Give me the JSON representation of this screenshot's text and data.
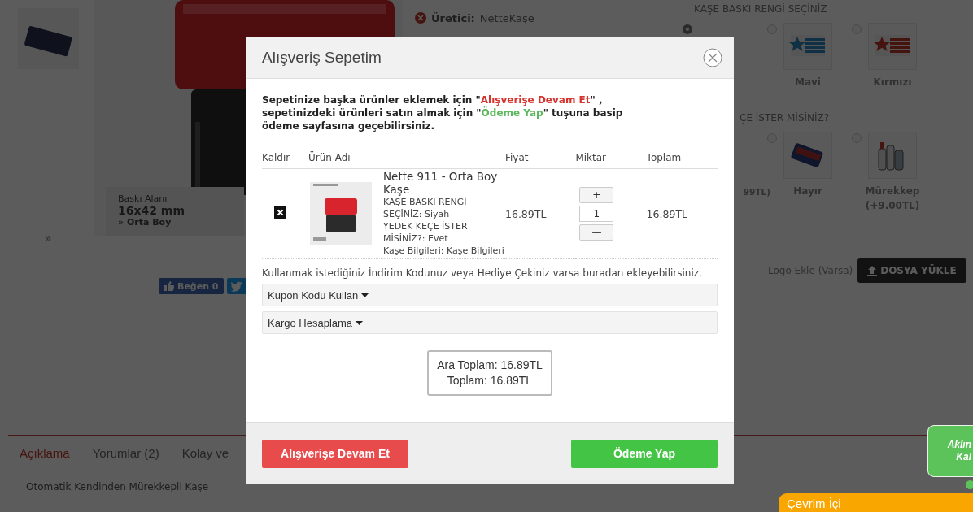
{
  "product_page": {
    "gallery_next": "»",
    "stamp_area": {
      "label": "Baskı Alanı",
      "size": "16x42 mm",
      "type": "» Orta Boy"
    },
    "like_button": "Beğen 0",
    "manufacturer": {
      "label": "Üretici:",
      "value": "NetteKaşe"
    },
    "option_groups": [
      {
        "title": "KAŞE BASKI RENGİ SEÇİNİZ",
        "options": [
          {
            "kind": "plain",
            "selected": true
          },
          {
            "kind": "blue-flag",
            "label": "Mavi",
            "selected": false
          },
          {
            "kind": "red-flag",
            "label": "Kırmızı",
            "selected": false
          }
        ]
      },
      {
        "title": "ÇE İSTER MİSİNİZ?",
        "options": [
          {
            "kind": "plain",
            "label": "99TL)"
          },
          {
            "kind": "felt-pad",
            "label": "Hayır",
            "selected": false
          },
          {
            "kind": "ink-bottles",
            "label": "Mürekkep",
            "price": "(+9.00TL)",
            "selected": false
          }
        ]
      }
    ],
    "logo_label": "Logo Ekle (Varsa)",
    "upload_button": "DOSYA YÜKLE",
    "tabs": [
      {
        "label": "Açıklama",
        "selected": true
      },
      {
        "label": "Yorumlar (2)",
        "selected": false
      },
      {
        "label": "Kolay ve",
        "selected": false
      }
    ],
    "description": "Otomatik Kendinden Mürekkepli Kaşe"
  },
  "cart_modal": {
    "title": "Alışveriş Sepetim",
    "intro": [
      [
        {
          "kind": "plain",
          "text": "Sepetinize başka ürünler eklemek için \""
        },
        {
          "kind": "continue",
          "text": "Alışverişe Devam Et"
        },
        {
          "kind": "plain",
          "text": "\" ,"
        }
      ],
      [
        {
          "kind": "plain",
          "text": "sepetinizdeki ürünleri satın almak için \""
        },
        {
          "kind": "checkout",
          "text": "Ödeme Yap"
        },
        {
          "kind": "plain",
          "text": "\" tuşuna basip"
        }
      ],
      [
        {
          "kind": "plain",
          "text": "ödeme sayfasına geçebilirsiniz."
        }
      ]
    ],
    "columns": [
      "Kaldır",
      "Ürün Adı",
      "Fiyat",
      "Miktar",
      "Toplam"
    ],
    "items": [
      {
        "name": "Nette 911 - Orta Boy Kaşe",
        "options": [
          "KAŞE BASKI RENGİ SEÇİNİZ: Siyah",
          "YEDEK KEÇE İSTER MİSİNİZ?: Evet",
          "Kaşe Bilgileri: Kaşe Bilgileri"
        ],
        "price": "16.89TL",
        "increment": "+",
        "quantity": "1",
        "decrement": "—",
        "total": "16.89TL"
      }
    ],
    "coupon_note": "Kullanmak istediğiniz İndirim Kodunuz veya Hediye Çekiniz varsa buradan ekleyebilirsiniz.",
    "dropdowns": [
      "Kupon Kodu Kullan",
      "Kargo Hesaplama"
    ],
    "subtotal": "Ara Toplam: 16.89TL",
    "total": "Toplam: 16.89TL",
    "continue_button": "Alışverişe Devam Et",
    "checkout_button": "Ödeme Yap"
  },
  "chat": {
    "bubble_lines": [
      "Aklın",
      "Kal"
    ],
    "status": "Çevrim İçi"
  }
}
